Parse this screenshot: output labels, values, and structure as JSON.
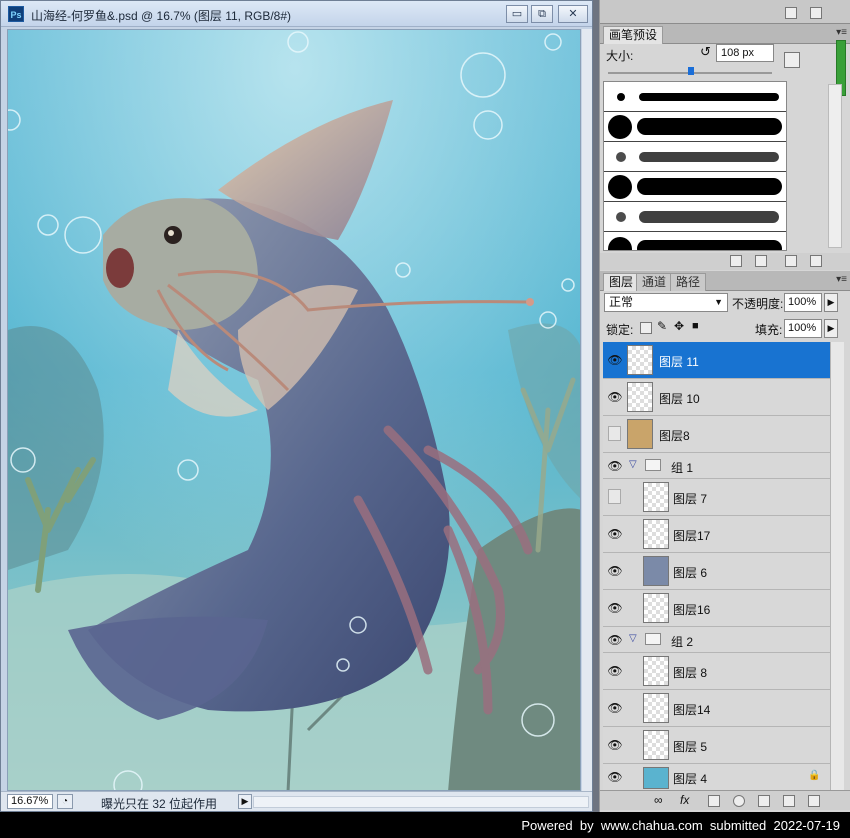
{
  "document": {
    "title": "山海经-何罗鱼&.psd @ 16.7% (图层 11, RGB/8#)",
    "app_icon": "Ps",
    "buttons": {
      "minimize": "▭",
      "restore": "⧉",
      "close": "✕"
    },
    "zoom": "16.67%",
    "status_message": "曝光只在 32 位起作用",
    "status_arrow": "▶"
  },
  "brush_panel": {
    "tab": "画笔预设",
    "size_label": "大小:",
    "size_value": "108 px",
    "menu_glyph": "▾≡"
  },
  "layers_panel": {
    "tabs": [
      "图层",
      "通道",
      "路径"
    ],
    "blend_mode": "正常",
    "opacity_label": "不透明度:",
    "opacity_value": "100%",
    "lock_label": "锁定:",
    "fill_label": "填充:",
    "fill_value": "100%",
    "layers": [
      {
        "name": "图层 11",
        "visible": true,
        "selected": true,
        "indent": 0,
        "type": "layer"
      },
      {
        "name": "图层 10",
        "visible": true,
        "selected": false,
        "indent": 0,
        "type": "layer"
      },
      {
        "name": "图层8",
        "visible": false,
        "selected": false,
        "indent": 0,
        "type": "layer"
      },
      {
        "name": "组 1",
        "visible": true,
        "selected": false,
        "indent": 0,
        "type": "group"
      },
      {
        "name": "图层 7",
        "visible": false,
        "selected": false,
        "indent": 1,
        "type": "layer"
      },
      {
        "name": "图层17",
        "visible": true,
        "selected": false,
        "indent": 1,
        "type": "layer"
      },
      {
        "name": "图层 6",
        "visible": true,
        "selected": false,
        "indent": 1,
        "type": "layer"
      },
      {
        "name": "图层16",
        "visible": true,
        "selected": false,
        "indent": 1,
        "type": "layer"
      },
      {
        "name": "组 2",
        "visible": true,
        "selected": false,
        "indent": 0,
        "type": "group"
      },
      {
        "name": "图层 8",
        "visible": true,
        "selected": false,
        "indent": 1,
        "type": "layer"
      },
      {
        "name": "图层14",
        "visible": true,
        "selected": false,
        "indent": 1,
        "type": "layer"
      },
      {
        "name": "图层 5",
        "visible": true,
        "selected": false,
        "indent": 1,
        "type": "layer"
      },
      {
        "name": "图层 4",
        "visible": true,
        "selected": false,
        "indent": 1,
        "type": "layer",
        "locked": true
      }
    ]
  },
  "footer": {
    "text": "Powered  by  www.chahua.com  submitted  2022-07-19"
  }
}
